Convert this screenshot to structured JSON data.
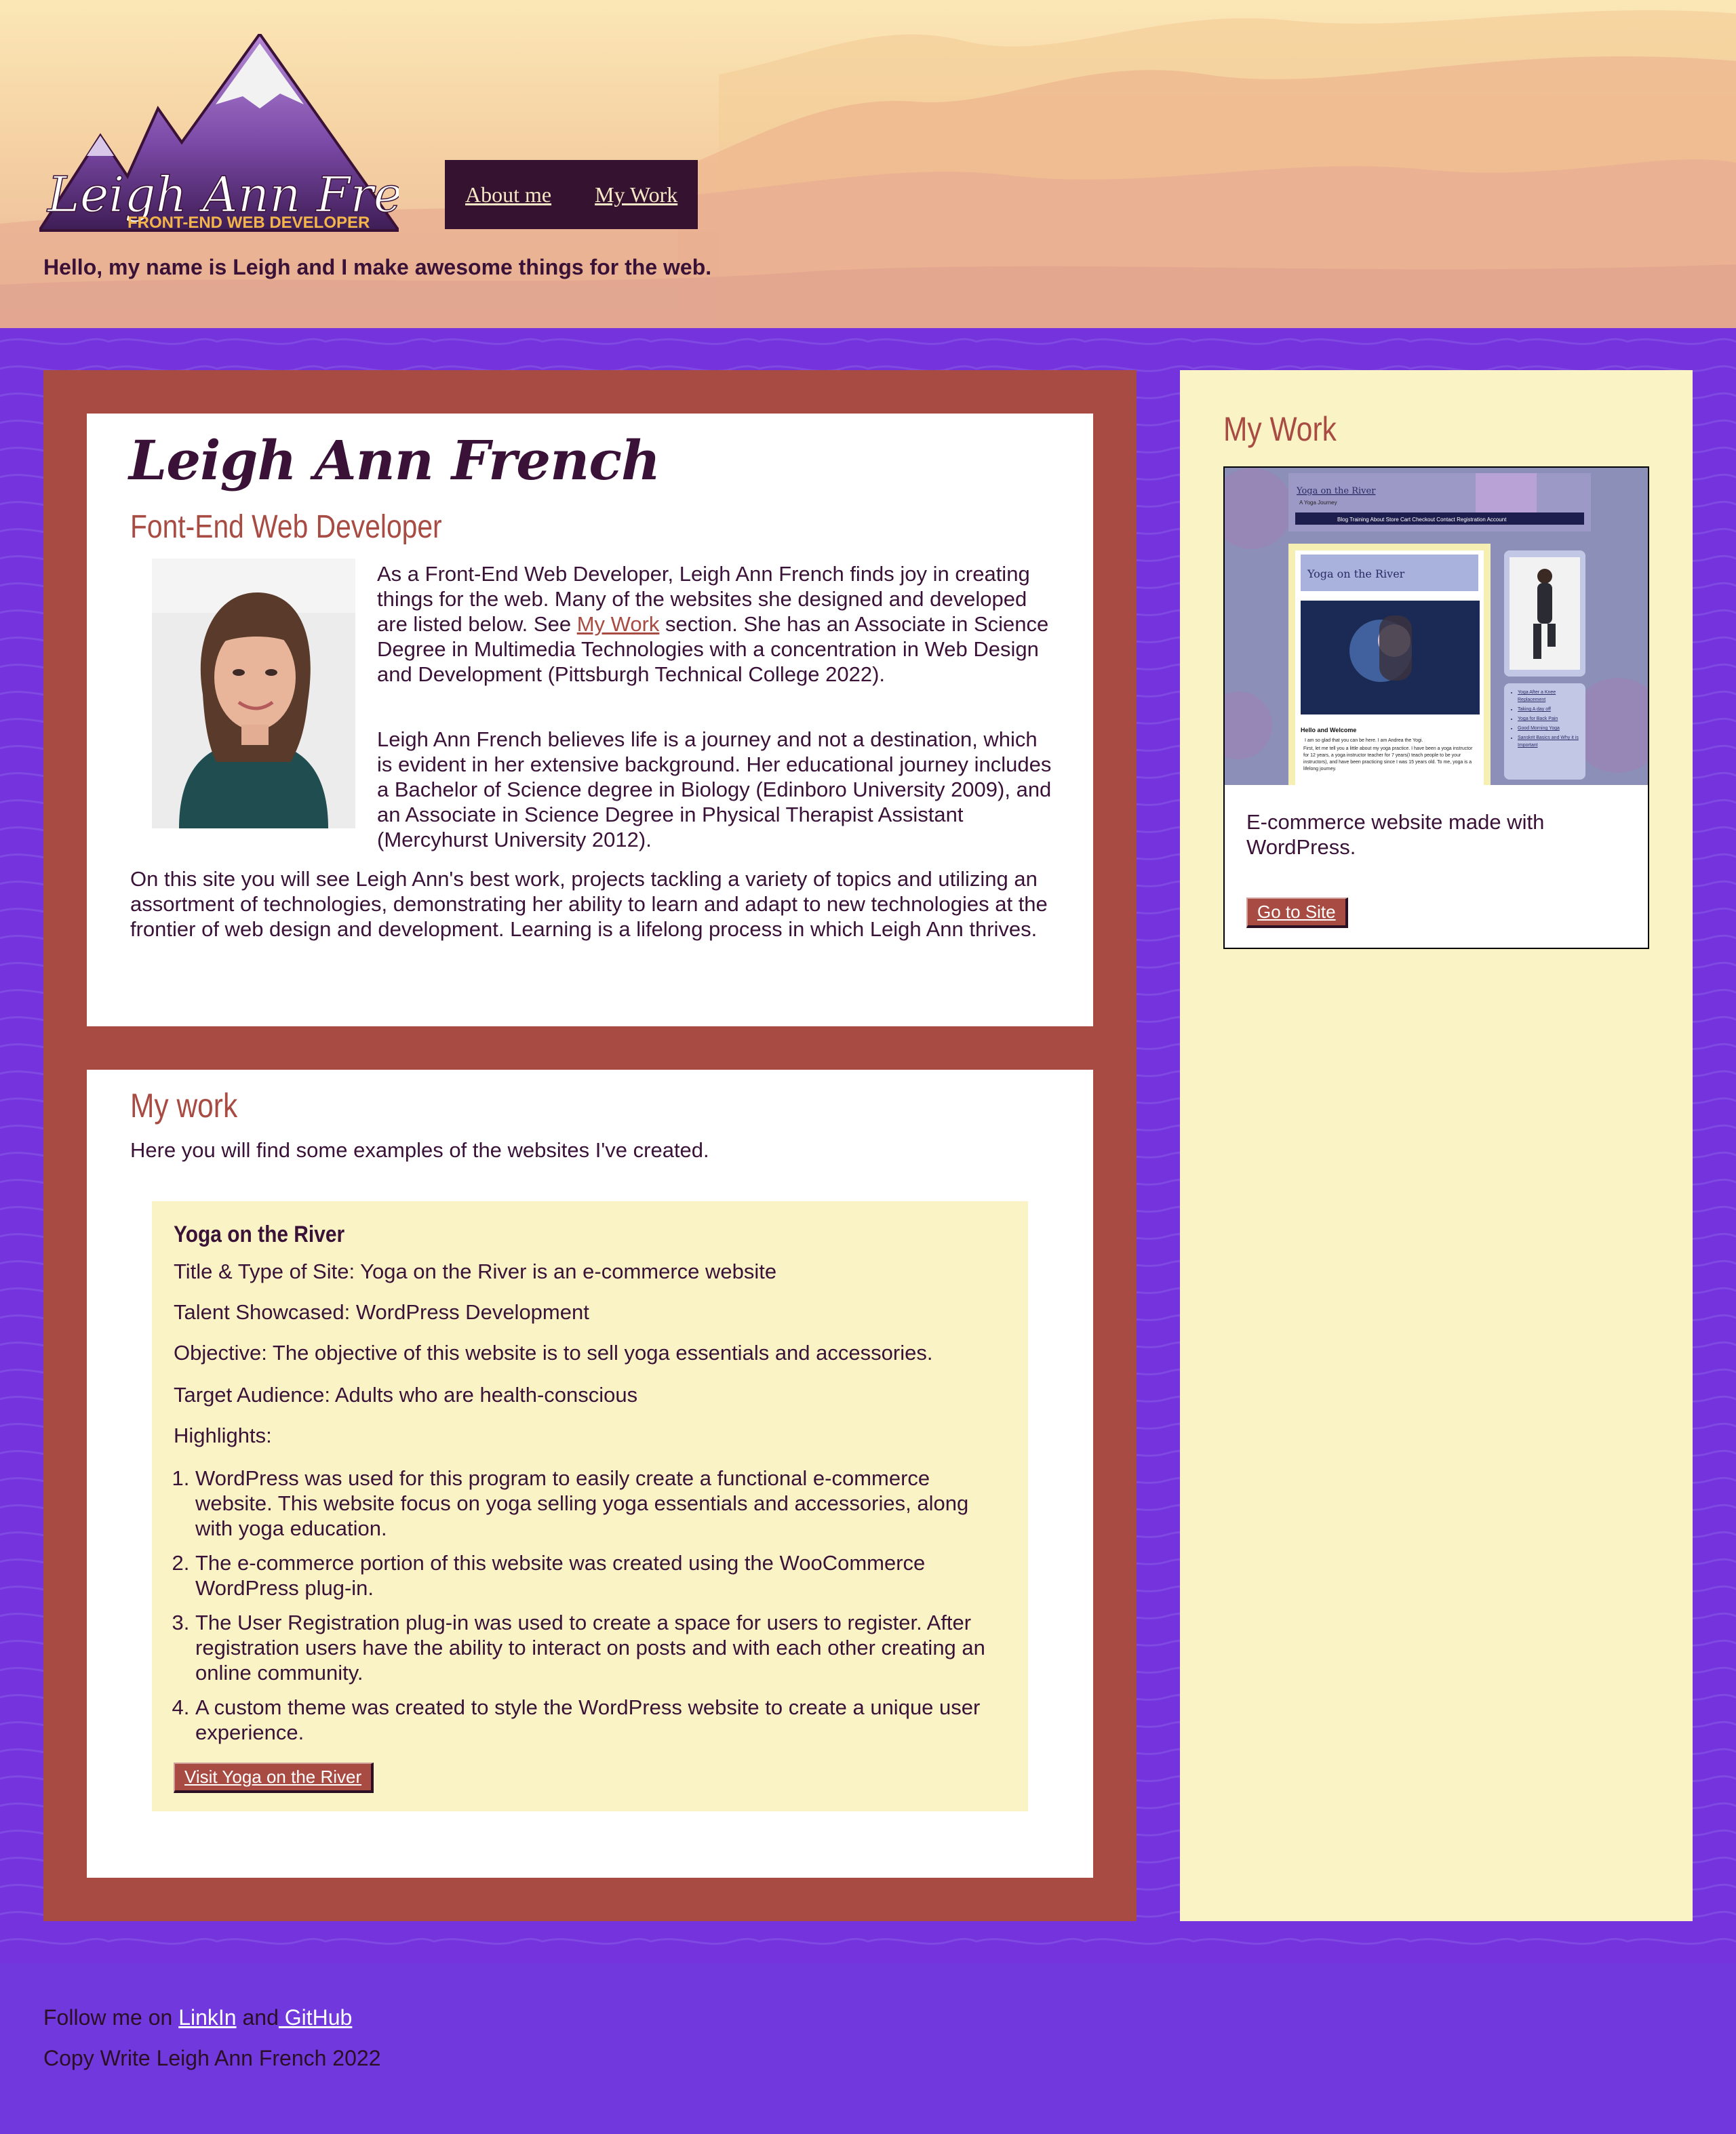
{
  "header": {
    "logo_name": "Leigh Ann French",
    "logo_subtitle": "FRONT-END WEB DEVELOPER",
    "nav": [
      {
        "label": "About me"
      },
      {
        "label": "My Work"
      }
    ],
    "tagline": "Hello, my name is Leigh and I make awesome things for the web."
  },
  "about": {
    "name": "Leigh Ann French",
    "role": "Font-End Web Developer",
    "p1_before": "As a Front-End Web Developer, Leigh Ann French finds joy in creating things for the web. Many of the websites she designed and developed are listed below. See ",
    "p1_link": "My Work",
    "p1_after": " section. She has an Associate in Science Degree in Multimedia Technologies with a concentration in Web Design and Development (Pittsburgh Technical College 2022).",
    "p2": "Leigh Ann French believes life is a journey and not a destination, which is evident in her extensive background. Her educational journey includes a Bachelor of Science degree in Biology (Edinboro University 2009), and an Associate in Science Degree in Physical Therapist Assistant (Mercyhurst University 2012).",
    "p3": "On this site you will see Leigh Ann's best work, projects tackling a variety of topics and utilizing an assortment of technologies, demonstrating her ability to learn and adapt to new technologies at the frontier of web design and development. Learning is a lifelong process in which Leigh Ann thrives."
  },
  "work": {
    "title": "My work",
    "intro": "Here you will find some examples of the websites I've created.",
    "project": {
      "title": "Yoga on the River",
      "type": "Title & Type of Site: Yoga on the River is an e-commerce website",
      "talent": "Talent Showcased: WordPress Development",
      "objective": "Objective: The objective of this website is to sell yoga essentials and accessories.",
      "audience": "Target Audience: Adults who are health-conscious",
      "highlights_label": "Highlights:",
      "highlights": [
        "WordPress was used for this program to easily create a functional e-commerce website. This website focus on yoga selling yoga essentials and accessories, along with yoga education.",
        "The e-commerce portion of this website was created using the WooCommerce WordPress plug-in.",
        "The User Registration plug-in was used to create a space for users to register. After registration users have the ability to interact on posts and with each other creating an online community.",
        "A custom theme was created to style the WordPress website to create a unique user experience."
      ],
      "button": "Visit Yoga on the River"
    }
  },
  "sidebar": {
    "title": "My Work",
    "screenshot": {
      "site_title": "Yoga on the River",
      "site_tagline": "A Yoga Journey",
      "menu": [
        "Blog",
        "Training",
        "About",
        "Store",
        "Cart",
        "Checkout",
        "Contact",
        "Registration",
        "Account"
      ],
      "hero_title": "Yoga on the River",
      "welcome_heading": "Hello and Welcome",
      "welcome_line1": "I am so glad that you can be here. I am Andrea the Yogi.",
      "welcome_line2": "First, let me tell you a little about my yoga practice. I have been a yoga instructor for 12 years, a yoga instructor teacher for 7 years(I teach people to be your instructors), and have been practicing since I was 15 years old. To me, yoga is a lifelong journey.",
      "links": [
        "Yoga After a Knee Replacement",
        "Taking A day off",
        "Yoga for Back Pain",
        "Good Morning Yoga",
        "Sanskrit Basics and Why it is Important"
      ]
    },
    "description": "E-commerce website made with WordPress.",
    "button": "Go to Site"
  },
  "footer": {
    "follow_prefix": "Follow me on ",
    "linkedin": "LinkIn",
    "and": " and",
    "github": " GitHub",
    "copyright": "Copy Write Leigh Ann French 2022"
  },
  "colors": {
    "plum": "#3a1238",
    "brick": "#a84b42",
    "cream": "#faf3c6",
    "purple": "#7038dd",
    "nav_bg": "#35122f"
  }
}
